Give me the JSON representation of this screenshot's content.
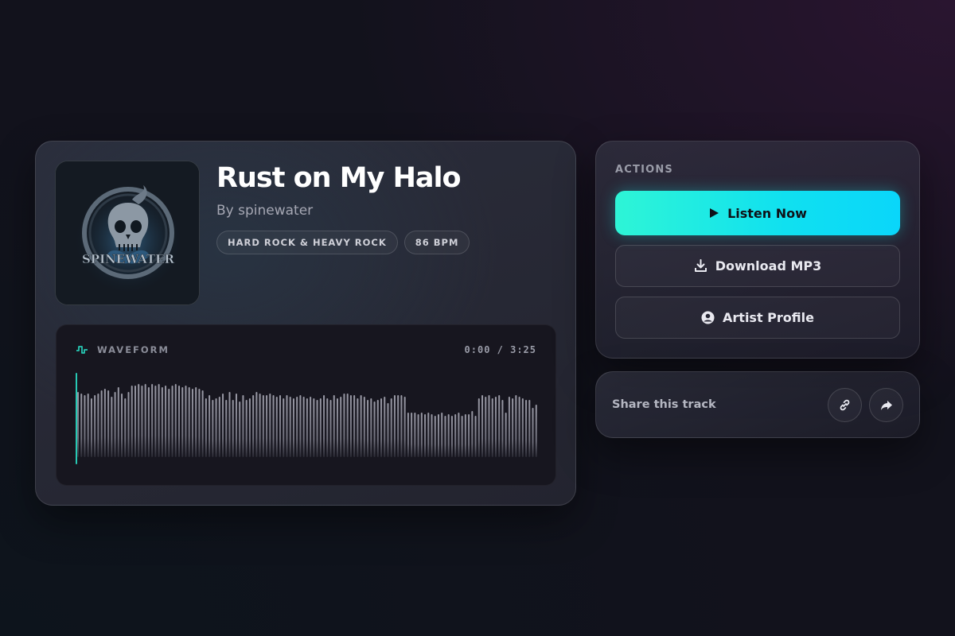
{
  "track": {
    "title": "Rust on My Halo",
    "artist": "By spinewater",
    "cover_text": "SPINEWATER",
    "tags": [
      "HARD ROCK & HEAVY ROCK",
      "86 BPM"
    ]
  },
  "waveform": {
    "label": "WAVEFORM",
    "time": "0:00 / 3:25",
    "progress": 0,
    "accent_color": "#27c9b4",
    "levels": [
      0.82,
      0.8,
      0.78,
      0.8,
      0.74,
      0.78,
      0.8,
      0.84,
      0.86,
      0.84,
      0.76,
      0.82,
      0.88,
      0.8,
      0.74,
      0.82,
      0.9,
      0.9,
      0.92,
      0.9,
      0.92,
      0.88,
      0.92,
      0.9,
      0.92,
      0.88,
      0.9,
      0.86,
      0.9,
      0.92,
      0.9,
      0.88,
      0.9,
      0.88,
      0.86,
      0.88,
      0.86,
      0.84,
      0.74,
      0.78,
      0.72,
      0.74,
      0.76,
      0.8,
      0.72,
      0.82,
      0.72,
      0.8,
      0.7,
      0.78,
      0.72,
      0.74,
      0.78,
      0.82,
      0.8,
      0.78,
      0.78,
      0.8,
      0.78,
      0.76,
      0.78,
      0.74,
      0.78,
      0.76,
      0.74,
      0.76,
      0.78,
      0.76,
      0.74,
      0.76,
      0.74,
      0.72,
      0.74,
      0.78,
      0.74,
      0.72,
      0.78,
      0.74,
      0.76,
      0.8,
      0.8,
      0.78,
      0.78,
      0.74,
      0.78,
      0.76,
      0.72,
      0.74,
      0.7,
      0.72,
      0.74,
      0.76,
      0.68,
      0.74,
      0.78,
      0.78,
      0.78,
      0.76,
      0.56,
      0.56,
      0.56,
      0.54,
      0.56,
      0.54,
      0.56,
      0.54,
      0.52,
      0.54,
      0.56,
      0.52,
      0.54,
      0.52,
      0.54,
      0.56,
      0.52,
      0.54,
      0.54,
      0.58,
      0.52,
      0.74,
      0.78,
      0.76,
      0.78,
      0.74,
      0.76,
      0.78,
      0.72,
      0.56,
      0.76,
      0.74,
      0.78,
      0.76,
      0.74,
      0.72,
      0.72,
      0.62,
      0.66
    ]
  },
  "actions": {
    "title": "ACTIONS",
    "listen_label": "Listen Now",
    "download_label": "Download MP3",
    "profile_label": "Artist Profile"
  },
  "share": {
    "label": "Share this track"
  },
  "colors": {
    "accent_start": "#2ef5d6",
    "accent_end": "#0ad6fa",
    "background": "#12121c"
  }
}
